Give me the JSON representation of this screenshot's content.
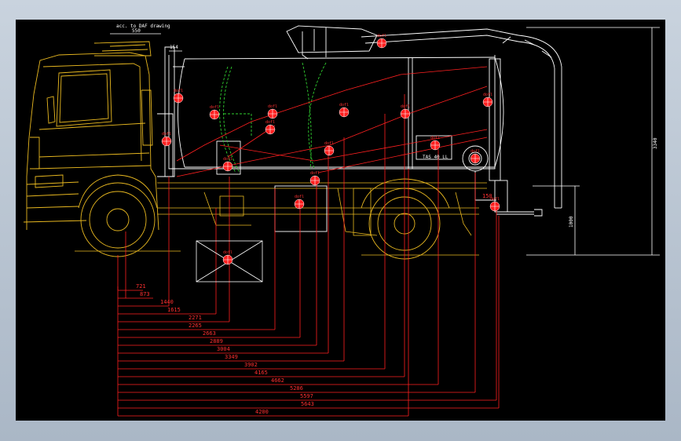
{
  "drawing": {
    "top_note": "acc. to DAF drawing",
    "top_dim_550": "550",
    "top_dim_154": "154",
    "height_dims": [
      "3340",
      "1000"
    ],
    "tank_label": "TAS 40 LL",
    "pump_label": "150",
    "bottom_dims": [
      "721",
      "873",
      "1440",
      "1615",
      "2271",
      "2265",
      "2663",
      "2889",
      "3004",
      "3349",
      "3902",
      "4165",
      "4662",
      "5286",
      "5597",
      "5643",
      "4200"
    ],
    "cog_marker_label": "dofl",
    "colors": {
      "background": "#000000",
      "truck": "#e8b820",
      "body": "#ffffff",
      "dimension": "#ff2020",
      "tank_inner": "#30d030"
    }
  }
}
